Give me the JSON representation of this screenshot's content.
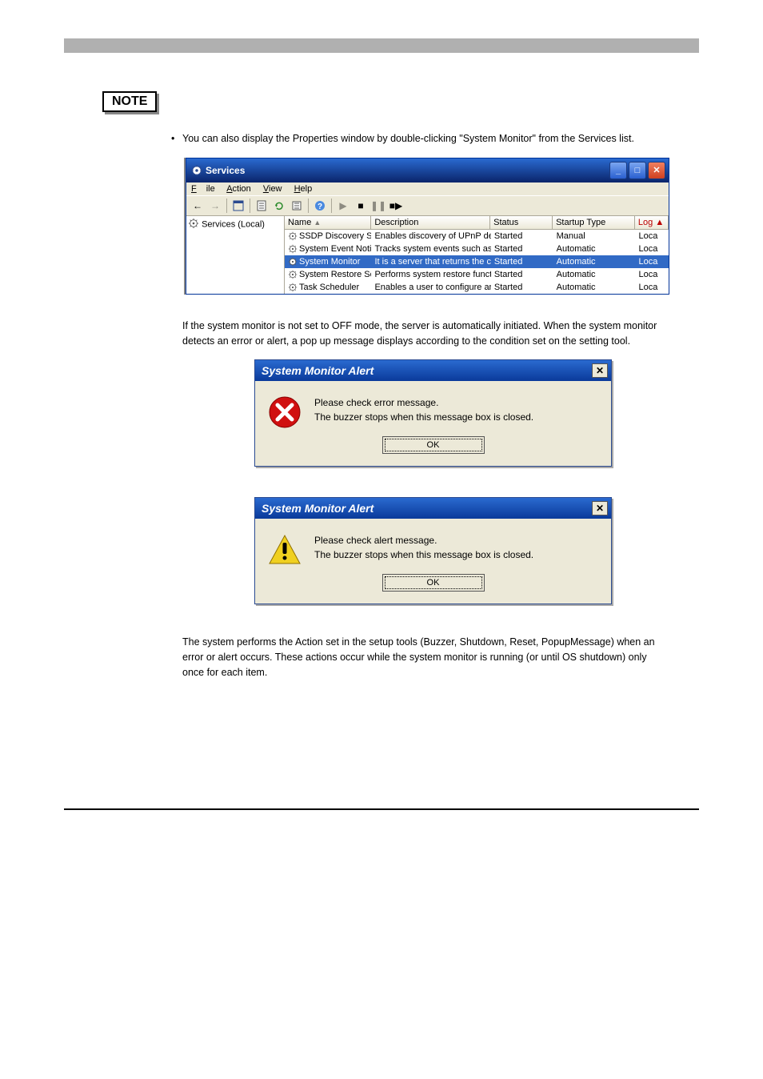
{
  "noteLabel": "NOTE",
  "note1": "You can also display the Properties window by double-clicking \"System Monitor\" from the Services list.",
  "servicesWindow": {
    "title": "Services",
    "menus": {
      "file": "File",
      "action": "Action",
      "view": "View",
      "help": "Help"
    },
    "tree": "Services (Local)",
    "columns": {
      "name": "Name",
      "desc": "Description",
      "status": "Status",
      "startup": "Startup Type",
      "log": "Log"
    },
    "rows": [
      {
        "name": "SSDP Discovery Ser...",
        "desc": "Enables discovery of UPnP devic...",
        "status": "Started",
        "startup": "Manual",
        "log": "Loca"
      },
      {
        "name": "System Event Notifi...",
        "desc": "Tracks system events such as W...",
        "status": "Started",
        "startup": "Automatic",
        "log": "Loca"
      },
      {
        "name": "System Monitor",
        "desc": "It is a server that returns the cli...",
        "status": "Started",
        "startup": "Automatic",
        "log": "Loca",
        "selected": true
      },
      {
        "name": "System Restore Ser...",
        "desc": "Performs system restore functio...",
        "status": "Started",
        "startup": "Automatic",
        "log": "Loca"
      },
      {
        "name": "Task Scheduler",
        "desc": "Enables a user to configure and ...",
        "status": "Started",
        "startup": "Automatic",
        "log": "Loca"
      }
    ]
  },
  "introPara": "If the system monitor is not set to OFF mode, the server is automatically initiated. When the system monitor detects an error or alert, a pop up message displays according to the condition set on the setting tool.",
  "alert1": {
    "title": "System Monitor Alert",
    "line1": "Please check error message.",
    "line2": "The buzzer stops when this message box is closed.",
    "ok": "OK"
  },
  "alert2": {
    "title": "System Monitor Alert",
    "line1": "Please check alert message.",
    "line2": "The buzzer stops when this message box is closed.",
    "ok": "OK"
  },
  "bottomPara": "The system performs the Action set in the setup tools (Buzzer, Shutdown, Reset, PopupMessage) when an error or alert occurs. These actions occur while the system monitor is running (or until OS shutdown) only once for each item."
}
